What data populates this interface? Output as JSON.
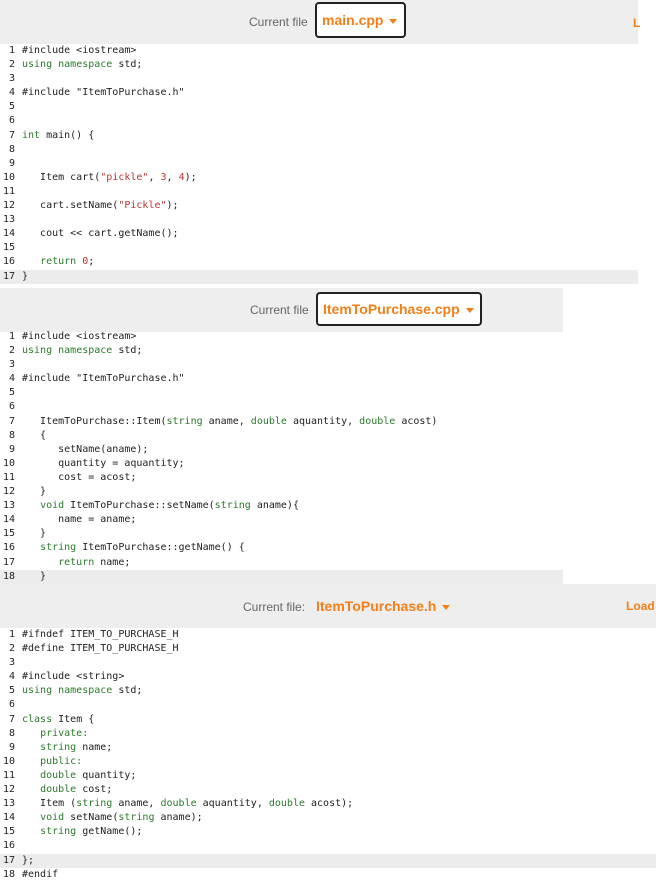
{
  "panels": [
    {
      "id": "main",
      "header": {
        "label": "Current file",
        "filename": "main.cpp",
        "load": "L"
      },
      "lines": [
        "#include <iostream>",
        "using namespace std;",
        "",
        "#include \"ItemToPurchase.h\"",
        "",
        "",
        "int main() {",
        "",
        "",
        "   Item cart(\"pickle\", 3, 4);",
        "",
        "   cart.setName(\"Pickle\");",
        "",
        "   cout << cart.getName();",
        "",
        "   return 0;",
        "}"
      ],
      "current_line": 17
    },
    {
      "id": "itemtopurchase-cpp",
      "header": {
        "label": "Current file",
        "filename": "ItemToPurchase.cpp"
      },
      "lines": [
        "#include <iostream>",
        "using namespace std;",
        "",
        "#include \"ItemToPurchase.h\"",
        "",
        "",
        "   ItemToPurchase::Item(string aname, double aquantity, double acost)",
        "   {",
        "      setName(aname);",
        "      quantity = aquantity;",
        "      cost = acost;",
        "   }",
        "   void ItemToPurchase::setName(string aname){",
        "      name = aname;",
        "   }",
        "   string ItemToPurchase::getName() {",
        "      return name;",
        "   }"
      ],
      "current_line": 18
    },
    {
      "id": "itemtopurchase-h",
      "header": {
        "label": "Current file:",
        "filename": "ItemToPurchase.h",
        "load": "Load"
      },
      "lines": [
        "#ifndef ITEM_TO_PURCHASE_H",
        "#define ITEM_TO_PURCHASE_H",
        "",
        "#include <string>",
        "using namespace std;",
        "",
        "class Item {",
        "   private:",
        "   string name;",
        "   public:",
        "   double quantity;",
        "   double cost;",
        "   Item (string aname, double aquantity, double acost);",
        "   void setName(string aname);",
        "   string getName();",
        "",
        "};",
        "#endif"
      ],
      "current_line": 17
    }
  ],
  "colors": {
    "accent": "#f57f17",
    "keyword": "#2a7a2a",
    "string": "#b33333"
  }
}
